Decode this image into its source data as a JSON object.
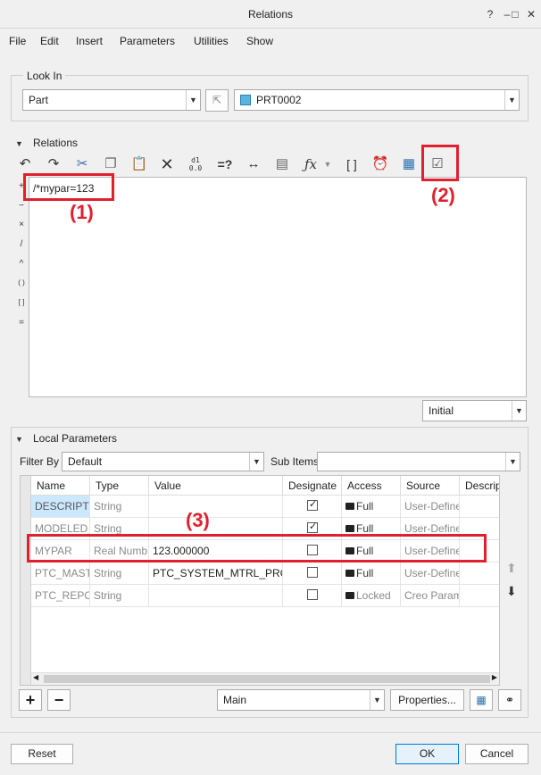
{
  "window": {
    "title": "Relations",
    "controls": [
      "?",
      "–",
      "□",
      "✕"
    ]
  },
  "menu": [
    "File",
    "Edit",
    "Insert",
    "Parameters",
    "Utilities",
    "Show"
  ],
  "look_in": {
    "label": "Look In",
    "type_value": "Part",
    "model_value": "PRT0002"
  },
  "relations": {
    "label": "Relations",
    "editor_text": "/*mypar=123",
    "side_operators": [
      "+",
      "−",
      "×",
      "/",
      "^",
      "( )",
      "[ ]",
      "="
    ],
    "toolbar_icons": [
      "undo-icon",
      "redo-icon",
      "cut-icon",
      "copy-icon",
      "paste-icon",
      "delete-icon",
      "display-values-icon",
      "evaluate-icon",
      "insert-dimension-icon",
      "sort-icon",
      "insert-function-icon",
      "parentheses-icon",
      "units-icon",
      "insert-parameter-icon",
      "verify-relations-icon"
    ],
    "insert_params_glyph": "d1\n0.0",
    "evaluate_glyph": "=?",
    "function_glyph": "ƒx",
    "brackets_glyph": "[ ]",
    "phase_value": "Initial"
  },
  "local_parameters": {
    "label": "Local Parameters",
    "filter_by_label": "Filter By",
    "filter_by_value": "Default",
    "sub_items_label": "Sub Items",
    "sub_items_value": "",
    "columns": [
      "Name",
      "Type",
      "Value",
      "Designate",
      "Access",
      "Source",
      "Descrip"
    ],
    "rows": [
      {
        "name": "DESCRIPTIC",
        "type": "String",
        "value": "",
        "designate": true,
        "access": "Full",
        "source": "User-Define"
      },
      {
        "name": "MODELED_",
        "type": "String",
        "value": "",
        "designate": true,
        "access": "Full",
        "source": "User-Define"
      },
      {
        "name": "MYPAR",
        "type": "Real Numb",
        "value": "123.000000",
        "designate": false,
        "access": "Full",
        "source": "User-Define"
      },
      {
        "name": "PTC_MASTE",
        "type": "String",
        "value": "PTC_SYSTEM_MTRL_PROPS",
        "designate": false,
        "access": "Full",
        "source": "User-Define"
      },
      {
        "name": "PTC_REPOR",
        "type": "String",
        "value": "",
        "designate": false,
        "access": "Locked",
        "source": "Creo Param"
      }
    ],
    "add_button": "+",
    "remove_button": "−",
    "view_value": "Main",
    "properties_button": "Properties..."
  },
  "footer": {
    "reset": "Reset",
    "ok": "OK",
    "cancel": "Cancel"
  },
  "annotations": {
    "callout_1": "(1)",
    "callout_2": "(2)",
    "callout_3": "(3)",
    "color": "#e0202e"
  },
  "colors": {
    "selected_row_bg": "#cce8ff",
    "name_highlight": "#cce8ff",
    "ok_border": "#0078d7"
  }
}
